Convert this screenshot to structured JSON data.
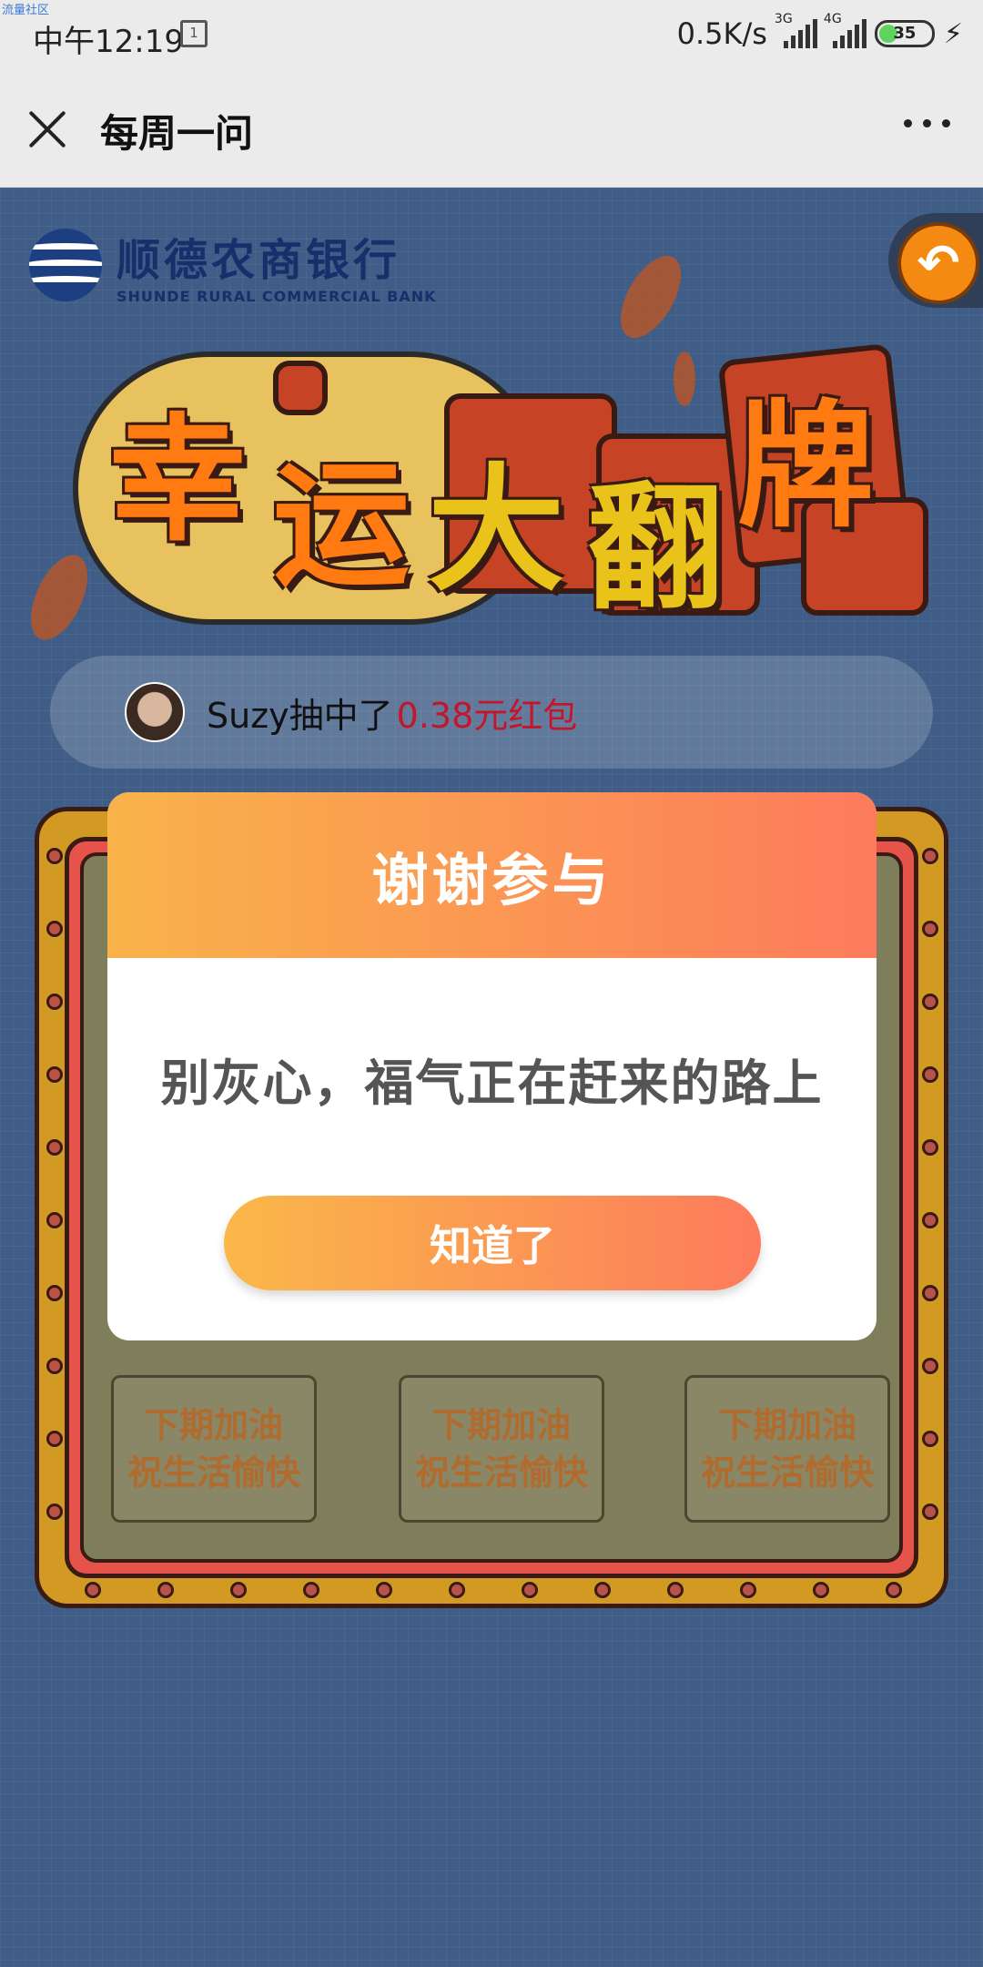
{
  "status_bar": {
    "watermark": "流量社区",
    "time": "中午12:19",
    "calendar_day": "1",
    "speed": "0.5K/s",
    "sim1": "3G",
    "sim2": "4G",
    "battery": "35"
  },
  "titlebar": {
    "title": "每周一问"
  },
  "bank": {
    "name_cn": "顺德农商银行",
    "name_en": "SHUNDE RURAL COMMERCIAL BANK"
  },
  "game_title": [
    "幸",
    "运",
    "大",
    "翻",
    "牌"
  ],
  "ticker": {
    "text": "Suzy抽中了",
    "prize": "0.38元红包"
  },
  "cards": [
    {
      "line1": "下期加油",
      "line2": "祝生活愉快"
    },
    {
      "line1": "下期加油",
      "line2": "祝生活愉快"
    },
    {
      "line1": "下期加油",
      "line2": "祝生活愉快"
    }
  ],
  "modal": {
    "title": "谢谢参与",
    "message": "别灰心，福气正在赶来的路上",
    "button": "知道了"
  },
  "colors": {
    "page_bg": "#3f5d86",
    "modal_gradient_start": "#f9b34a",
    "modal_gradient_end": "#fd7b5c",
    "prize_red": "#c3162a"
  }
}
